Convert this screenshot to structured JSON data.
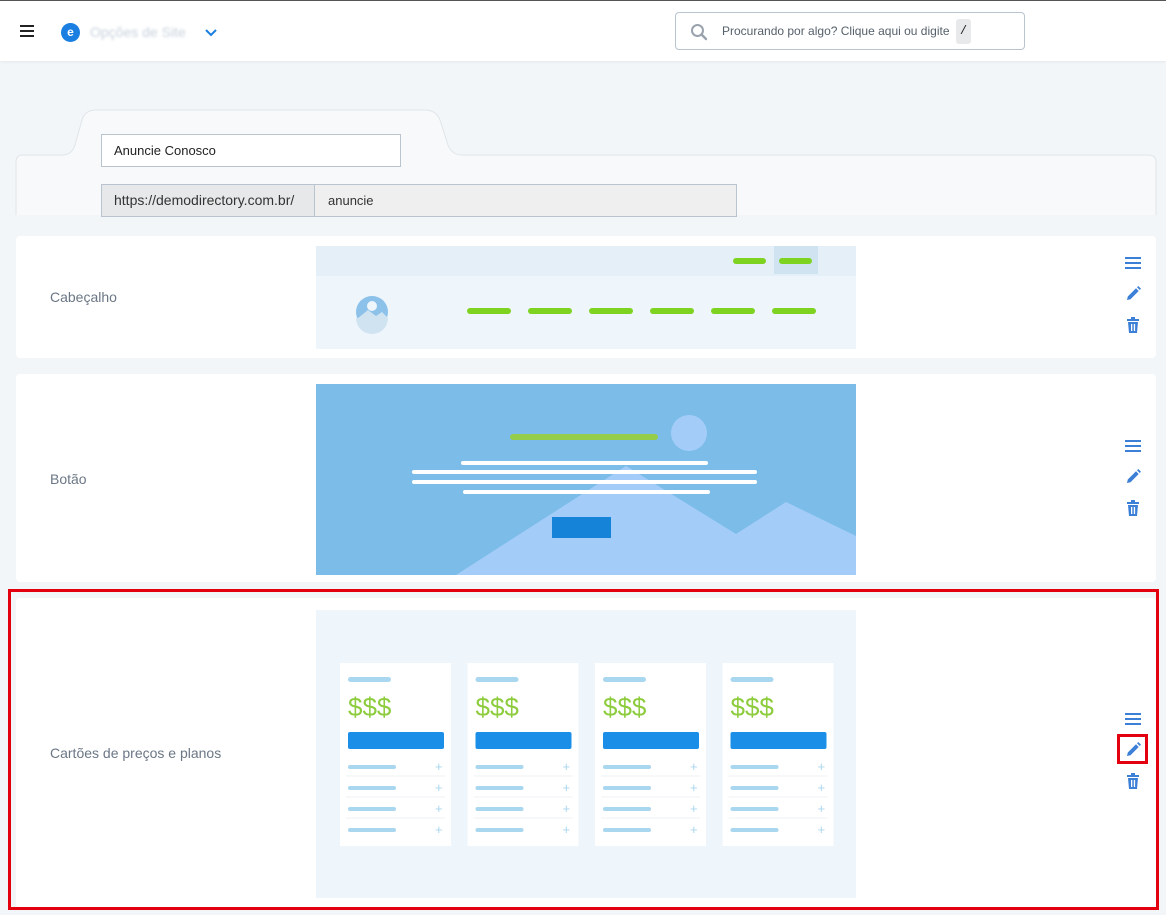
{
  "topbar": {
    "logo_letter": "e",
    "site_name": "Opções de Site",
    "search_placeholder": "Procurando por algo? Clique aqui ou digite",
    "search_shortcut": "/"
  },
  "page": {
    "title_value": "Anuncie Conosco",
    "url_prefix": "https://demodirectory.com.br/",
    "url_slug": "anuncie"
  },
  "sections": [
    {
      "label": "Cabeçalho"
    },
    {
      "label": "Botão"
    },
    {
      "label": "Cartões de preços e planos"
    }
  ],
  "pricing_preview": {
    "price_text": "$$$",
    "plus": "+"
  },
  "colors": {
    "accent": "#1a7fe0",
    "icon_blue": "#3c7fd6",
    "green": "#7ed321",
    "highlight_red": "#e3000f"
  },
  "icons": [
    "menu-icon",
    "chevron-down-icon",
    "search-icon",
    "reorder-icon",
    "edit-icon",
    "trash-icon"
  ]
}
